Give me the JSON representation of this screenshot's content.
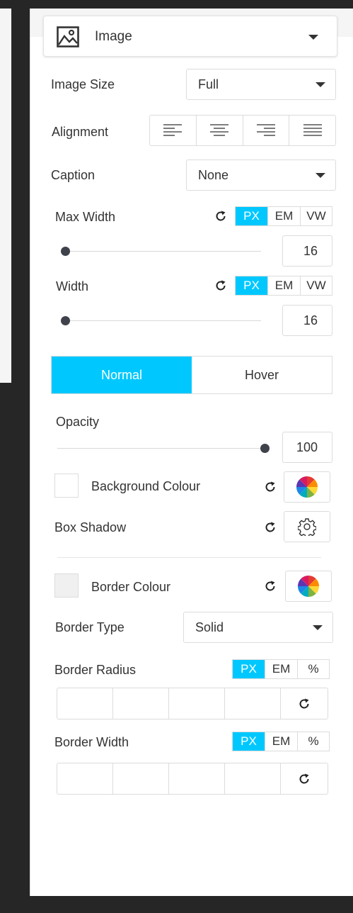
{
  "header": {
    "title": "Image",
    "icon": "image-icon"
  },
  "image_size": {
    "label": "Image Size",
    "value": "Full"
  },
  "alignment": {
    "label": "Alignment",
    "options": [
      "align-left-icon",
      "align-center-icon",
      "align-right-icon",
      "align-justify-icon"
    ]
  },
  "caption": {
    "label": "Caption",
    "value": "None"
  },
  "max_width": {
    "label": "Max Width",
    "units": [
      "PX",
      "EM",
      "VW"
    ],
    "active_unit": "PX",
    "value": "16",
    "slider_fraction": 0.0
  },
  "width": {
    "label": "Width",
    "units": [
      "PX",
      "EM",
      "VW"
    ],
    "active_unit": "PX",
    "value": "16",
    "slider_fraction": 0.0
  },
  "state_tabs": {
    "normal": "Normal",
    "hover": "Hover",
    "active": "Normal"
  },
  "opacity": {
    "label": "Opacity",
    "value": "100",
    "slider_fraction": 1.0
  },
  "background_colour": {
    "label": "Background Colour"
  },
  "box_shadow": {
    "label": "Box Shadow"
  },
  "border_colour": {
    "label": "Border Colour"
  },
  "border_type": {
    "label": "Border Type",
    "value": "Solid"
  },
  "border_radius": {
    "label": "Border Radius",
    "units": [
      "PX",
      "EM",
      "%"
    ],
    "active_unit": "PX"
  },
  "border_width": {
    "label": "Border Width",
    "units": [
      "PX",
      "EM",
      "%"
    ],
    "active_unit": "PX"
  },
  "colors": {
    "accent": "#00c8ff",
    "knob": "#3f424a",
    "border": "#dcdcdc",
    "background": "#262626"
  }
}
